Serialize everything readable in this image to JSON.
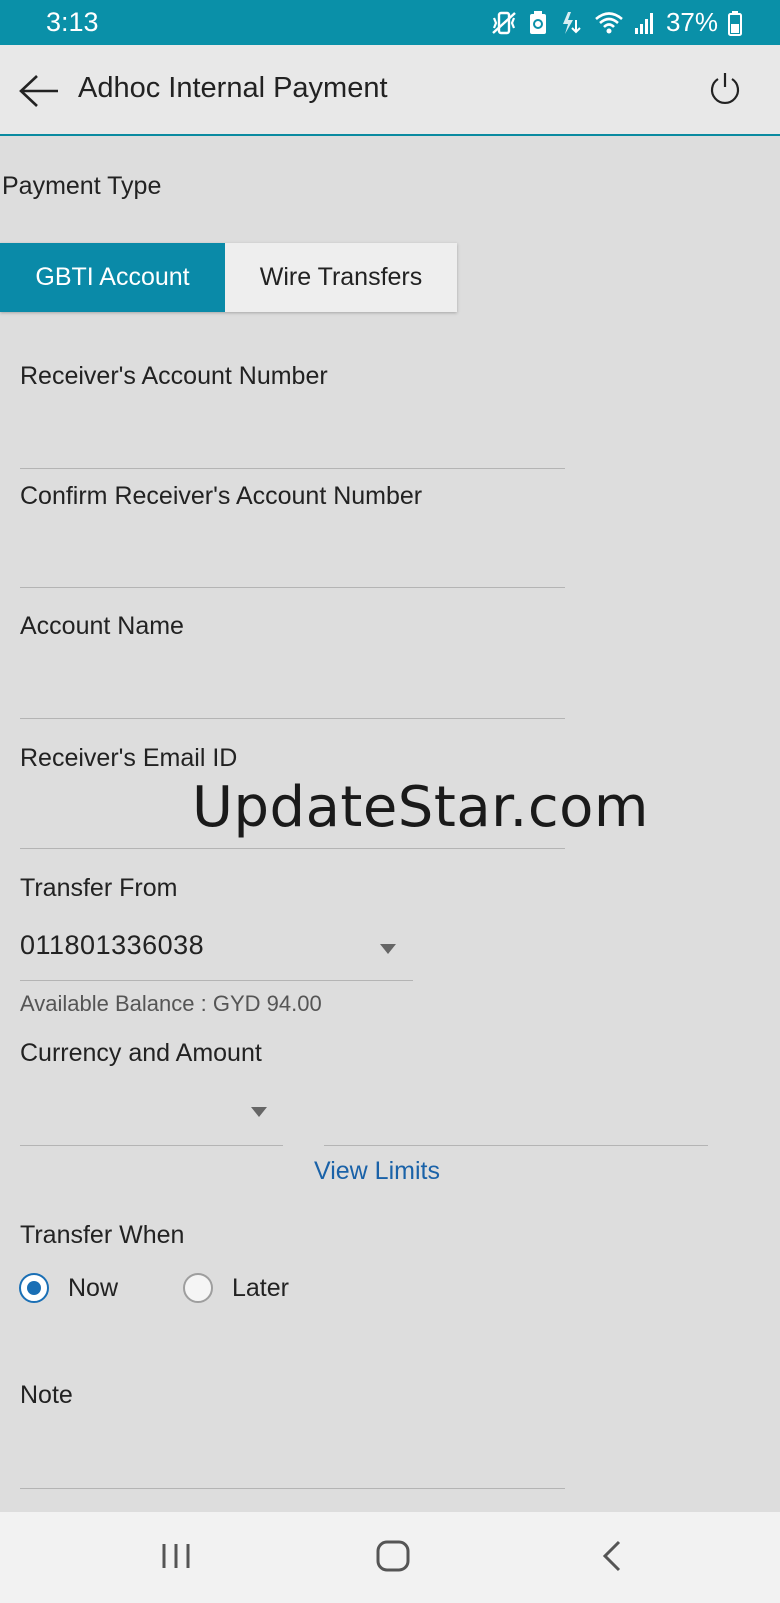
{
  "status_bar": {
    "time": "3:13",
    "battery": "37%",
    "icons": [
      "vibrate-icon",
      "recycle-icon",
      "data-icon",
      "wifi-icon",
      "signal-icon",
      "battery-icon"
    ]
  },
  "header": {
    "title": "Adhoc Internal Payment",
    "icons": [
      "back-arrow-icon",
      "power-icon"
    ]
  },
  "payment_type": {
    "label": "Payment Type",
    "options": [
      "GBTI Account",
      "Wire Transfers"
    ],
    "selected": "GBTI Account"
  },
  "form": {
    "receiver_account_label": "Receiver's Account Number",
    "receiver_account_value": "",
    "confirm_account_label": "Confirm Receiver's Account Number",
    "confirm_account_value": "",
    "account_name_label": "Account Name",
    "account_name_value": "",
    "email_label": "Receiver's Email ID",
    "email_value": "",
    "transfer_from_label": "Transfer From",
    "transfer_from_value": "011801336038",
    "available_balance": "Available Balance : GYD 94.00",
    "currency_amount_label": "Currency and Amount",
    "currency_value": "",
    "amount_value": "",
    "view_limits": "View Limits",
    "transfer_when_label": "Transfer When",
    "transfer_when_options": [
      "Now",
      "Later"
    ],
    "transfer_when_selected": "Now",
    "note_label": "Note",
    "note_value": ""
  },
  "watermark": "UpdateStar.com",
  "nav_bar": {
    "icons": [
      "recents-icon",
      "home-icon",
      "back-icon"
    ]
  },
  "colors": {
    "accent": "#0a8aa8",
    "link": "#1a62a8",
    "radio": "#1a6fb5"
  }
}
